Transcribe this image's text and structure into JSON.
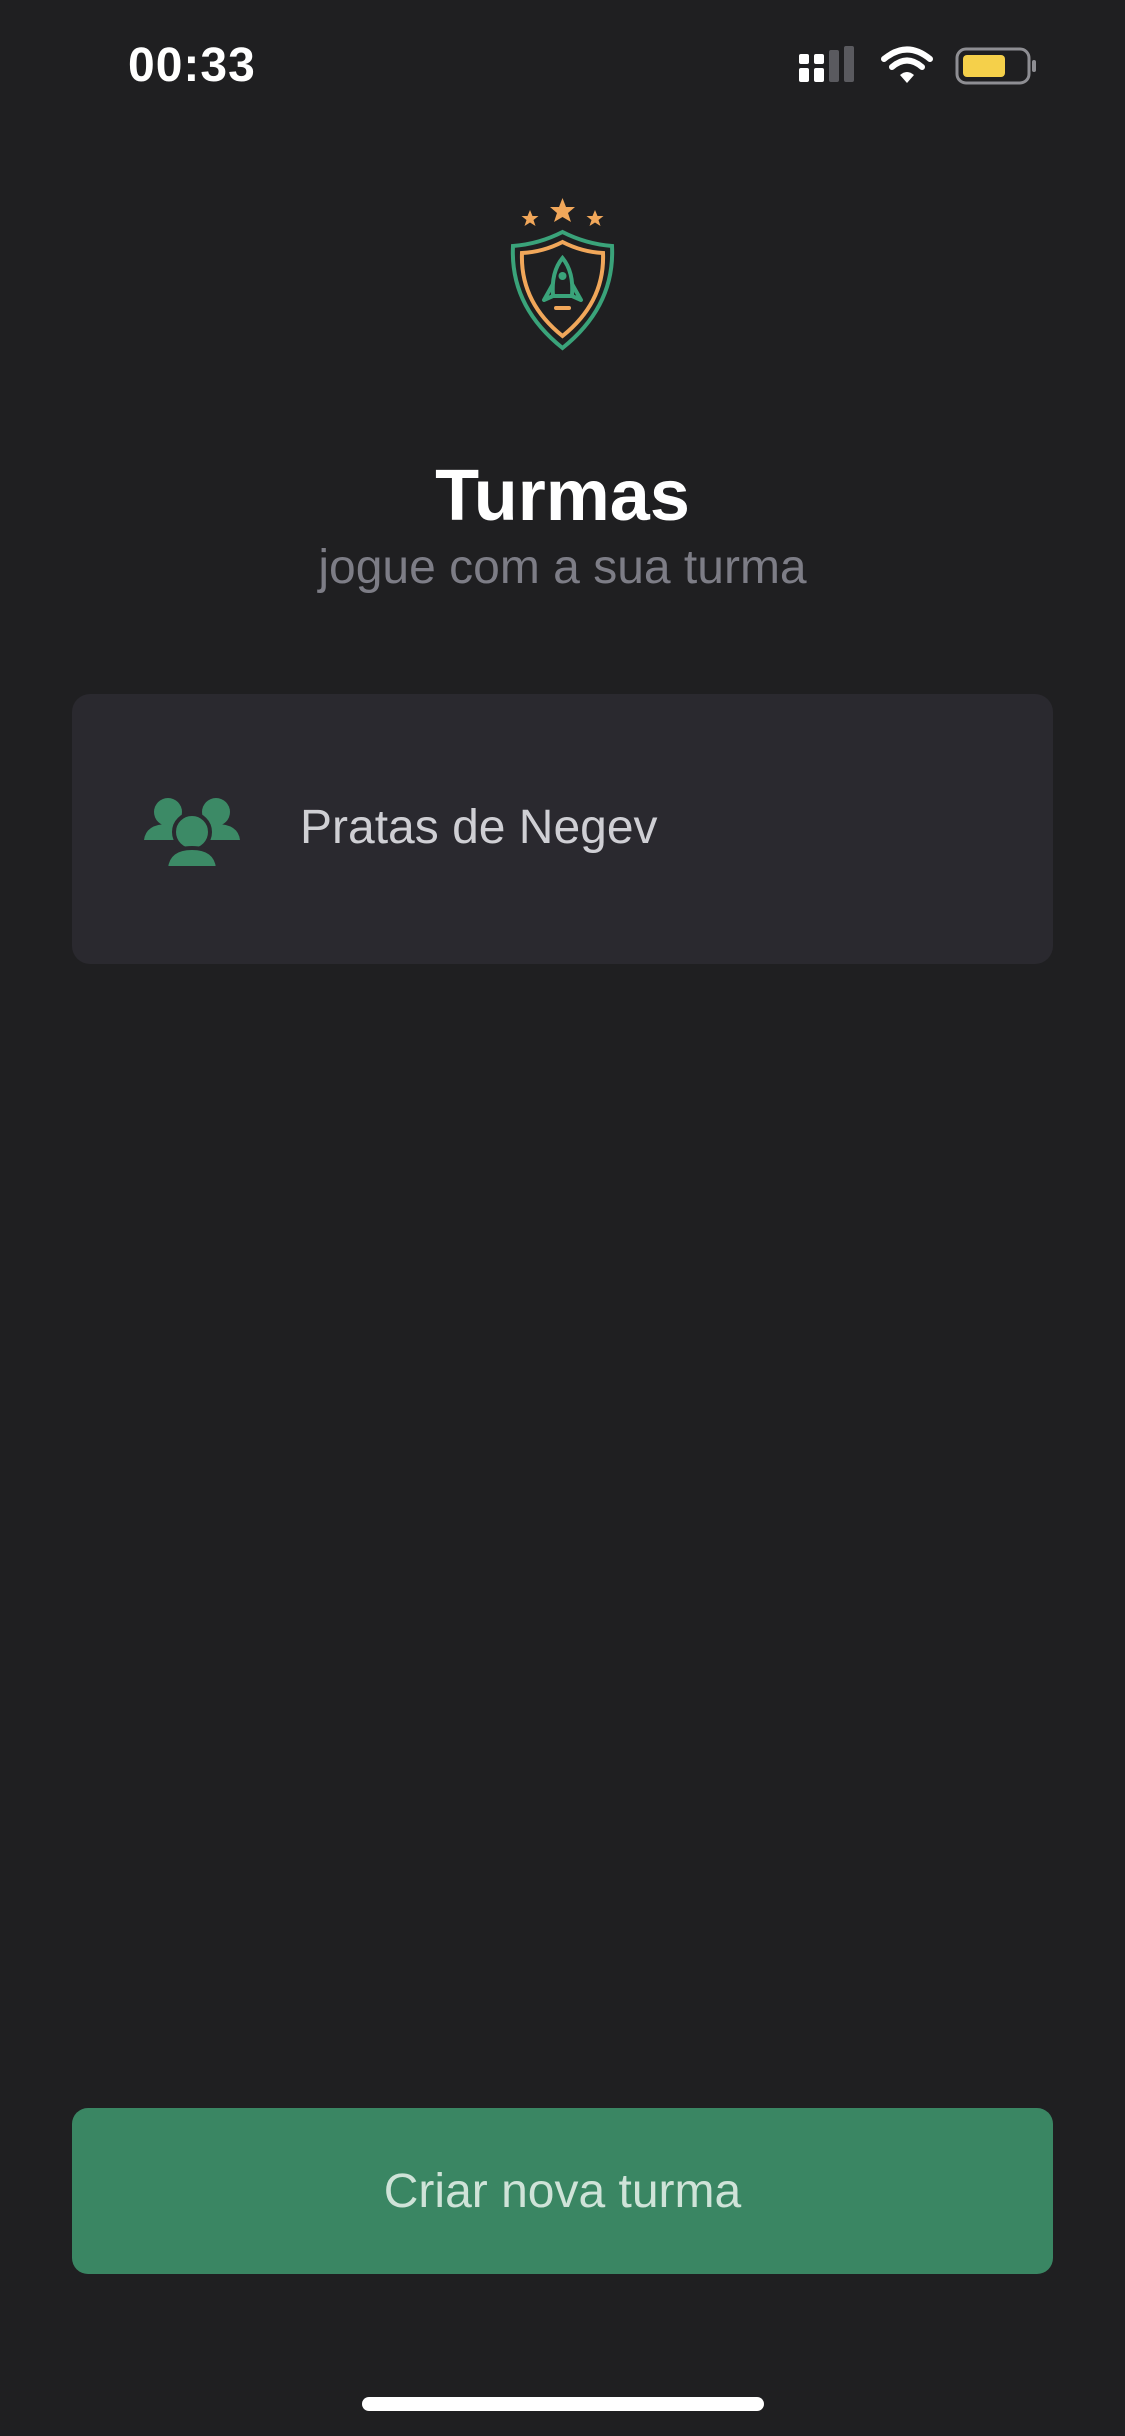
{
  "status_bar": {
    "time": "00:33",
    "icons": [
      "cellular-signal-icon",
      "wifi-icon",
      "battery-icon"
    ],
    "battery_color": "#f5d04a"
  },
  "header": {
    "logo_icon": "rocket-shield-icon",
    "title": "Turmas",
    "subtitle": "jogue com a sua turma"
  },
  "classes": [
    {
      "icon": "group-icon",
      "name": "Pratas de Negev"
    }
  ],
  "actions": {
    "create_label": "Criar nova turma"
  },
  "colors": {
    "background": "#1f1f21",
    "card": "#2a292f",
    "accent_green": "#3a8663",
    "icon_green": "#3c8a66",
    "logo_orange": "#f1a75a",
    "subtitle": "#7d7d86"
  }
}
